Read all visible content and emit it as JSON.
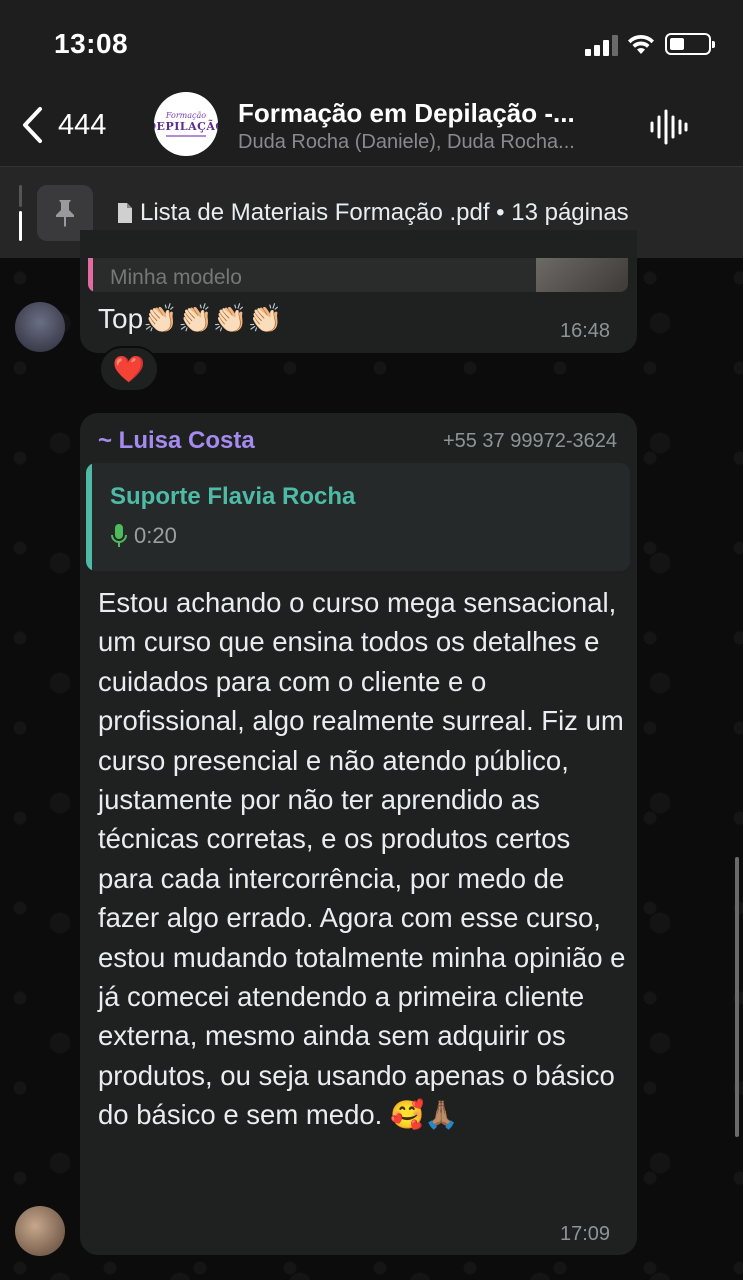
{
  "status_bar": {
    "time": "13:08",
    "battery_level": 0.3
  },
  "header": {
    "back_count": "444",
    "group_title": "Formação em Depilação -...",
    "group_subtitle": "Duda Rocha (Daniele), Duda Rocha...",
    "avatar_logo_top": "Formação",
    "avatar_logo_main": "DEPILAÇÃO"
  },
  "pinned": {
    "label": "Lista de Materiais Formação .pdf • 13 páginas"
  },
  "messages": [
    {
      "partial_quote_text": "Minha modelo",
      "text": "Top👏🏻👏🏻👏🏻👏🏻",
      "time": "16:48",
      "reaction": "❤️"
    },
    {
      "sender": "~ Luisa Costa",
      "phone": "+55 37 99972-3624",
      "quoted_name": "Suporte Flavia Rocha",
      "quoted_audio_duration": "0:20",
      "text": "Estou achando o curso mega sensacional, um curso que ensina todos os detalhes e cuidados para com o cliente e o profissional, algo realmente surreal. Fiz um curso presencial e não atendo público, justamente por não ter aprendido as técnicas corretas, e os produtos certos para cada intercorrência, por medo de fazer algo errado. Agora com esse curso, estou mudando totalmente minha opinião e já comecei atendendo a primeira cliente externa, mesmo ainda sem adquirir os produtos, ou seja usando apenas o básico do básico e sem medo. 🥰🙏🏽",
      "time": "17:09"
    }
  ],
  "colors": {
    "sender_name": "#a58aef",
    "quote_accent": "#4dbba6",
    "bubble": "#1f2121"
  }
}
